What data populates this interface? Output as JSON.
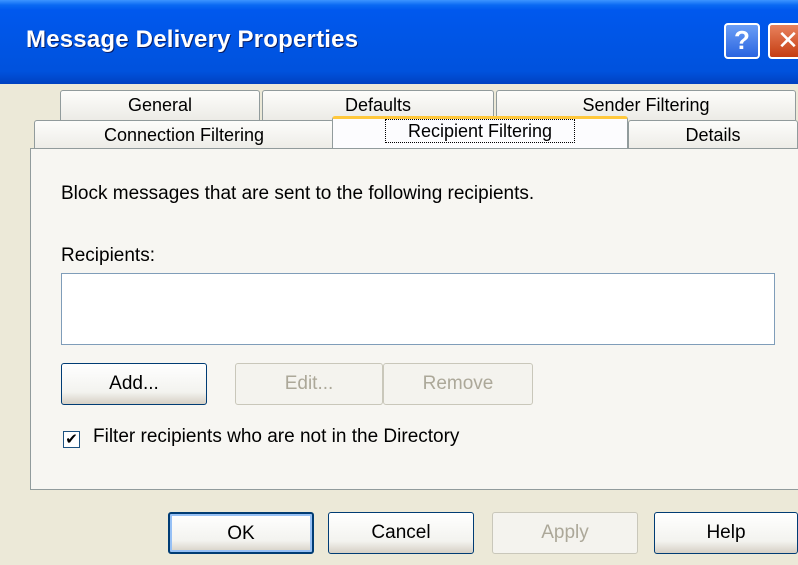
{
  "window": {
    "title": "Message Delivery Properties",
    "help_glyph": "?",
    "close_glyph": "✕"
  },
  "tabs": {
    "row1": [
      "General",
      "Defaults",
      "Sender Filtering"
    ],
    "row2": [
      "Connection Filtering",
      "Recipient Filtering",
      "Details"
    ],
    "active": "Recipient Filtering"
  },
  "panel": {
    "description": "Block messages that are sent to the following recipients.",
    "recipients_label": "Recipients:",
    "recipients": [],
    "buttons": {
      "add": "Add...",
      "edit": "Edit...",
      "remove": "Remove"
    },
    "checkbox": {
      "label": "Filter recipients who are not in the Directory",
      "checked": true,
      "mark": "✔"
    }
  },
  "footer": {
    "ok": "OK",
    "cancel": "Cancel",
    "apply": "Apply",
    "help": "Help"
  }
}
